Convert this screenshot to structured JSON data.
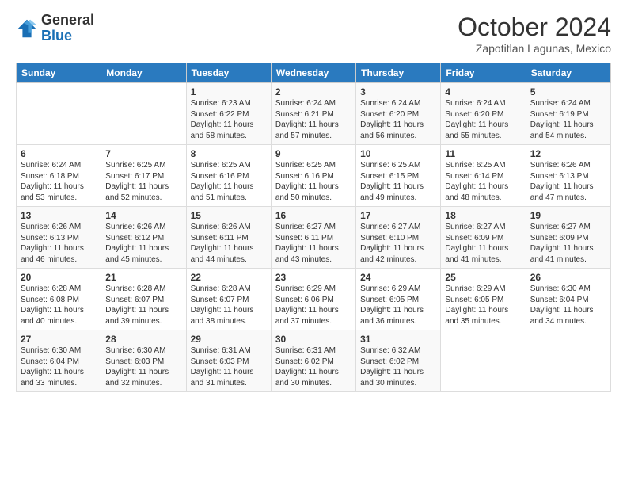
{
  "header": {
    "logo_general": "General",
    "logo_blue": "Blue",
    "month_title": "October 2024",
    "subtitle": "Zapotitlan Lagunas, Mexico"
  },
  "days_of_week": [
    "Sunday",
    "Monday",
    "Tuesday",
    "Wednesday",
    "Thursday",
    "Friday",
    "Saturday"
  ],
  "weeks": [
    [
      {
        "day": "",
        "sunrise": "",
        "sunset": "",
        "daylight": ""
      },
      {
        "day": "",
        "sunrise": "",
        "sunset": "",
        "daylight": ""
      },
      {
        "day": "1",
        "sunrise": "Sunrise: 6:23 AM",
        "sunset": "Sunset: 6:22 PM",
        "daylight": "Daylight: 11 hours and 58 minutes."
      },
      {
        "day": "2",
        "sunrise": "Sunrise: 6:24 AM",
        "sunset": "Sunset: 6:21 PM",
        "daylight": "Daylight: 11 hours and 57 minutes."
      },
      {
        "day": "3",
        "sunrise": "Sunrise: 6:24 AM",
        "sunset": "Sunset: 6:20 PM",
        "daylight": "Daylight: 11 hours and 56 minutes."
      },
      {
        "day": "4",
        "sunrise": "Sunrise: 6:24 AM",
        "sunset": "Sunset: 6:20 PM",
        "daylight": "Daylight: 11 hours and 55 minutes."
      },
      {
        "day": "5",
        "sunrise": "Sunrise: 6:24 AM",
        "sunset": "Sunset: 6:19 PM",
        "daylight": "Daylight: 11 hours and 54 minutes."
      }
    ],
    [
      {
        "day": "6",
        "sunrise": "Sunrise: 6:24 AM",
        "sunset": "Sunset: 6:18 PM",
        "daylight": "Daylight: 11 hours and 53 minutes."
      },
      {
        "day": "7",
        "sunrise": "Sunrise: 6:25 AM",
        "sunset": "Sunset: 6:17 PM",
        "daylight": "Daylight: 11 hours and 52 minutes."
      },
      {
        "day": "8",
        "sunrise": "Sunrise: 6:25 AM",
        "sunset": "Sunset: 6:16 PM",
        "daylight": "Daylight: 11 hours and 51 minutes."
      },
      {
        "day": "9",
        "sunrise": "Sunrise: 6:25 AM",
        "sunset": "Sunset: 6:16 PM",
        "daylight": "Daylight: 11 hours and 50 minutes."
      },
      {
        "day": "10",
        "sunrise": "Sunrise: 6:25 AM",
        "sunset": "Sunset: 6:15 PM",
        "daylight": "Daylight: 11 hours and 49 minutes."
      },
      {
        "day": "11",
        "sunrise": "Sunrise: 6:25 AM",
        "sunset": "Sunset: 6:14 PM",
        "daylight": "Daylight: 11 hours and 48 minutes."
      },
      {
        "day": "12",
        "sunrise": "Sunrise: 6:26 AM",
        "sunset": "Sunset: 6:13 PM",
        "daylight": "Daylight: 11 hours and 47 minutes."
      }
    ],
    [
      {
        "day": "13",
        "sunrise": "Sunrise: 6:26 AM",
        "sunset": "Sunset: 6:13 PM",
        "daylight": "Daylight: 11 hours and 46 minutes."
      },
      {
        "day": "14",
        "sunrise": "Sunrise: 6:26 AM",
        "sunset": "Sunset: 6:12 PM",
        "daylight": "Daylight: 11 hours and 45 minutes."
      },
      {
        "day": "15",
        "sunrise": "Sunrise: 6:26 AM",
        "sunset": "Sunset: 6:11 PM",
        "daylight": "Daylight: 11 hours and 44 minutes."
      },
      {
        "day": "16",
        "sunrise": "Sunrise: 6:27 AM",
        "sunset": "Sunset: 6:11 PM",
        "daylight": "Daylight: 11 hours and 43 minutes."
      },
      {
        "day": "17",
        "sunrise": "Sunrise: 6:27 AM",
        "sunset": "Sunset: 6:10 PM",
        "daylight": "Daylight: 11 hours and 42 minutes."
      },
      {
        "day": "18",
        "sunrise": "Sunrise: 6:27 AM",
        "sunset": "Sunset: 6:09 PM",
        "daylight": "Daylight: 11 hours and 41 minutes."
      },
      {
        "day": "19",
        "sunrise": "Sunrise: 6:27 AM",
        "sunset": "Sunset: 6:09 PM",
        "daylight": "Daylight: 11 hours and 41 minutes."
      }
    ],
    [
      {
        "day": "20",
        "sunrise": "Sunrise: 6:28 AM",
        "sunset": "Sunset: 6:08 PM",
        "daylight": "Daylight: 11 hours and 40 minutes."
      },
      {
        "day": "21",
        "sunrise": "Sunrise: 6:28 AM",
        "sunset": "Sunset: 6:07 PM",
        "daylight": "Daylight: 11 hours and 39 minutes."
      },
      {
        "day": "22",
        "sunrise": "Sunrise: 6:28 AM",
        "sunset": "Sunset: 6:07 PM",
        "daylight": "Daylight: 11 hours and 38 minutes."
      },
      {
        "day": "23",
        "sunrise": "Sunrise: 6:29 AM",
        "sunset": "Sunset: 6:06 PM",
        "daylight": "Daylight: 11 hours and 37 minutes."
      },
      {
        "day": "24",
        "sunrise": "Sunrise: 6:29 AM",
        "sunset": "Sunset: 6:05 PM",
        "daylight": "Daylight: 11 hours and 36 minutes."
      },
      {
        "day": "25",
        "sunrise": "Sunrise: 6:29 AM",
        "sunset": "Sunset: 6:05 PM",
        "daylight": "Daylight: 11 hours and 35 minutes."
      },
      {
        "day": "26",
        "sunrise": "Sunrise: 6:30 AM",
        "sunset": "Sunset: 6:04 PM",
        "daylight": "Daylight: 11 hours and 34 minutes."
      }
    ],
    [
      {
        "day": "27",
        "sunrise": "Sunrise: 6:30 AM",
        "sunset": "Sunset: 6:04 PM",
        "daylight": "Daylight: 11 hours and 33 minutes."
      },
      {
        "day": "28",
        "sunrise": "Sunrise: 6:30 AM",
        "sunset": "Sunset: 6:03 PM",
        "daylight": "Daylight: 11 hours and 32 minutes."
      },
      {
        "day": "29",
        "sunrise": "Sunrise: 6:31 AM",
        "sunset": "Sunset: 6:03 PM",
        "daylight": "Daylight: 11 hours and 31 minutes."
      },
      {
        "day": "30",
        "sunrise": "Sunrise: 6:31 AM",
        "sunset": "Sunset: 6:02 PM",
        "daylight": "Daylight: 11 hours and 30 minutes."
      },
      {
        "day": "31",
        "sunrise": "Sunrise: 6:32 AM",
        "sunset": "Sunset: 6:02 PM",
        "daylight": "Daylight: 11 hours and 30 minutes."
      },
      {
        "day": "",
        "sunrise": "",
        "sunset": "",
        "daylight": ""
      },
      {
        "day": "",
        "sunrise": "",
        "sunset": "",
        "daylight": ""
      }
    ]
  ]
}
